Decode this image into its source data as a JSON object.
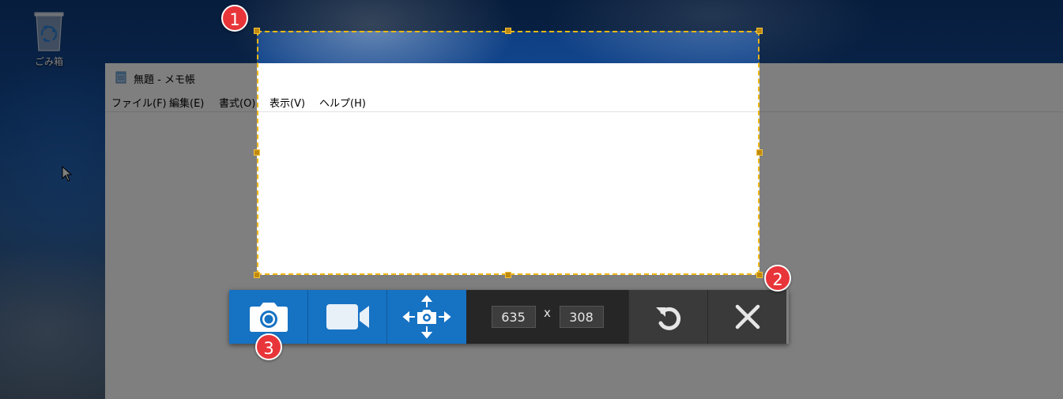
{
  "desktop": {
    "recycle_bin_label": "ごみ箱"
  },
  "notepad": {
    "title": "無題 - メモ帳",
    "menu": [
      "ファイル(F)",
      "編集(E)",
      "書式(O)",
      "表示(V)",
      "ヘルプ(H)"
    ]
  },
  "badges": [
    "1",
    "2",
    "3"
  ],
  "toolbar": {
    "width_value": "635",
    "height_value": "308",
    "separator": "x"
  },
  "colors": {
    "selection_border": "#f0b816",
    "toolbar_blue": "#1672c3",
    "toolbar_dark": "#3a3a3a",
    "badge_red": "#e8353a"
  },
  "icons": [
    "recycle-bin-icon",
    "mouse-cursor-icon",
    "notepad-icon",
    "camera-icon",
    "video-camera-icon",
    "move-camera-icon",
    "undo-icon",
    "close-icon"
  ]
}
